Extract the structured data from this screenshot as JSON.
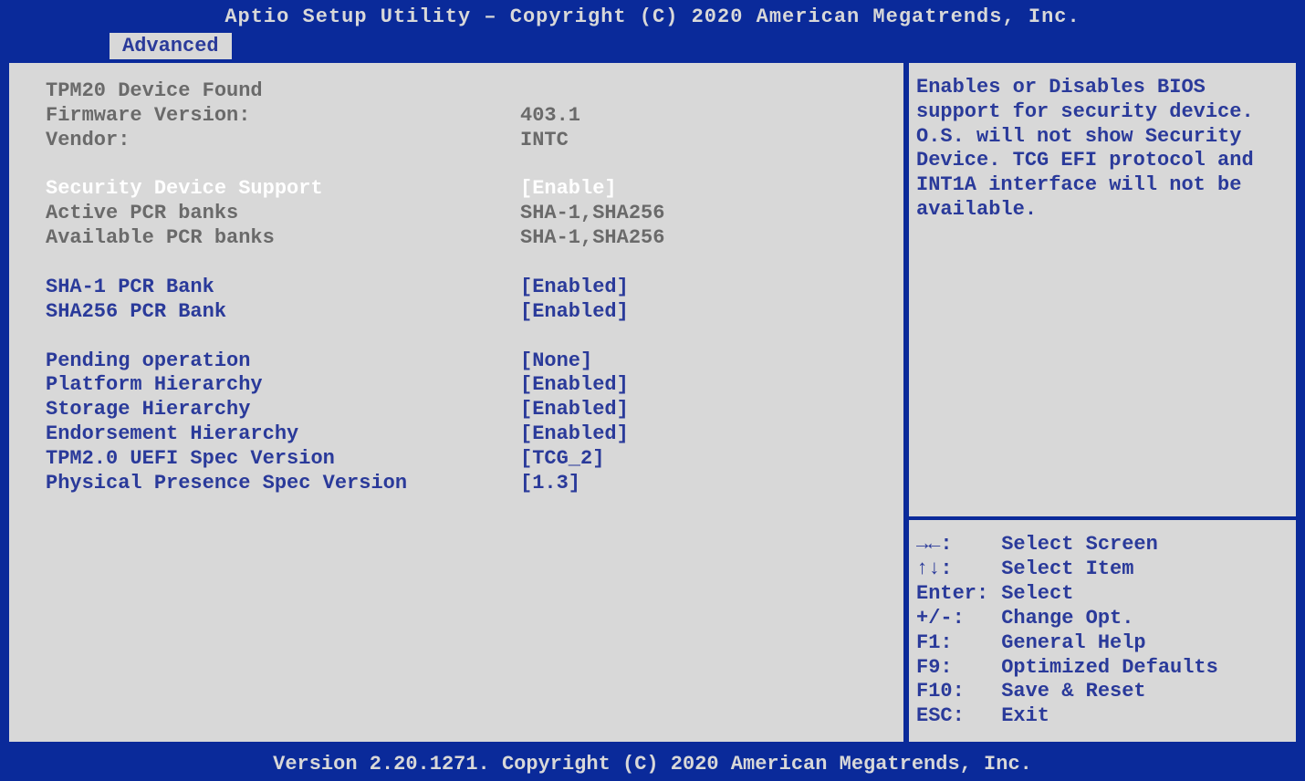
{
  "title": "Aptio Setup Utility – Copyright (C) 2020 American Megatrends, Inc.",
  "tab": "Advanced",
  "footer": "Version 2.20.1271. Copyright (C) 2020 American Megatrends, Inc.",
  "help": {
    "text": "Enables or Disables BIOS support for security device. O.S. will not show Security Device. TCG EFI protocol and INT1A interface will not be available.",
    "keys": [
      {
        "k": "→←:",
        "d": "Select Screen"
      },
      {
        "k": "↑↓:",
        "d": "Select Item"
      },
      {
        "k": "Enter:",
        "d": "Select"
      },
      {
        "k": "+/-:",
        "d": "Change Opt."
      },
      {
        "k": "F1:",
        "d": "General Help"
      },
      {
        "k": "F9:",
        "d": "Optimized Defaults"
      },
      {
        "k": "F10:",
        "d": "Save & Reset"
      },
      {
        "k": "ESC:",
        "d": "Exit"
      }
    ]
  },
  "rows": [
    {
      "type": "info",
      "label": "TPM20 Device Found",
      "value": ""
    },
    {
      "type": "info",
      "label": "Firmware Version:",
      "value": "403.1"
    },
    {
      "type": "info",
      "label": "Vendor:",
      "value": "INTC"
    },
    {
      "type": "blank"
    },
    {
      "type": "selected",
      "label": "Security Device Support",
      "value": "[Enable]"
    },
    {
      "type": "info",
      "label": "Active PCR banks",
      "value": "SHA-1,SHA256"
    },
    {
      "type": "info",
      "label": "Available PCR banks",
      "value": "SHA-1,SHA256"
    },
    {
      "type": "blank"
    },
    {
      "type": "option",
      "label": "SHA-1 PCR Bank",
      "value": "[Enabled]"
    },
    {
      "type": "option",
      "label": "SHA256 PCR Bank",
      "value": "[Enabled]"
    },
    {
      "type": "blank"
    },
    {
      "type": "option",
      "label": "Pending operation",
      "value": "[None]"
    },
    {
      "type": "option",
      "label": "Platform Hierarchy",
      "value": "[Enabled]"
    },
    {
      "type": "option",
      "label": "Storage Hierarchy",
      "value": "[Enabled]"
    },
    {
      "type": "option",
      "label": "Endorsement Hierarchy",
      "value": "[Enabled]"
    },
    {
      "type": "option",
      "label": "TPM2.0 UEFI Spec Version",
      "value": "[TCG_2]"
    },
    {
      "type": "option",
      "label": "Physical Presence Spec Version",
      "value": "[1.3]"
    }
  ]
}
